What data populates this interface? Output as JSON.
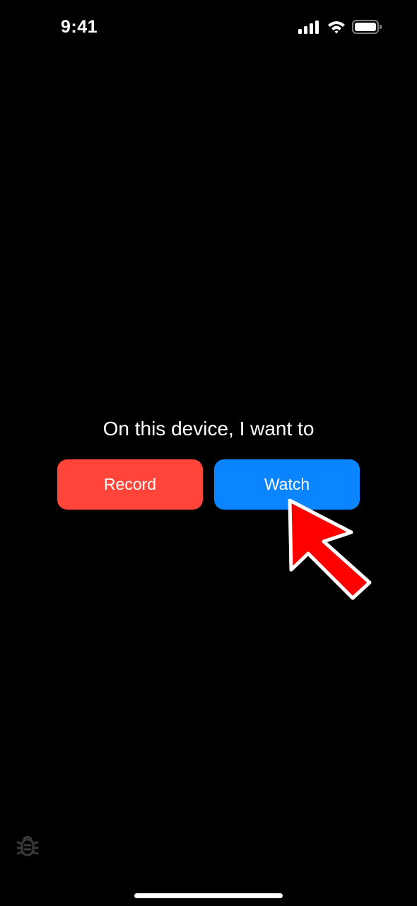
{
  "status_bar": {
    "time": "9:41",
    "icons": [
      "cellular-signal-icon",
      "wifi-icon",
      "battery-icon"
    ]
  },
  "main": {
    "prompt": "On this device, I want to",
    "record_label": "Record",
    "watch_label": "Watch"
  },
  "annotation": {
    "icon": "red-arrow-icon"
  },
  "footer": {
    "debug_icon": "bug-icon"
  },
  "colors": {
    "background": "#000000",
    "record": "#FF453A",
    "watch": "#0A84FF",
    "arrow": "#FF0000",
    "text": "#FFFFFF",
    "debug_icon": "#3A3A3C"
  }
}
